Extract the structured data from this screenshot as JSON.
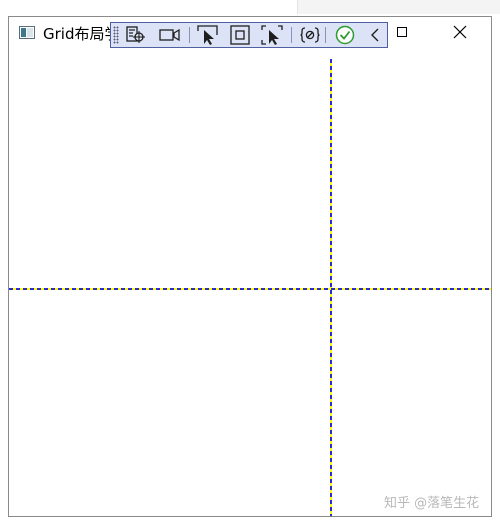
{
  "window": {
    "title": "Grid布局学"
  },
  "toolbar": {
    "buttons": [
      {
        "name": "live-visual-tree-icon"
      },
      {
        "name": "record-icon"
      },
      {
        "name": "select-element-icon"
      },
      {
        "name": "display-layout-adorners-icon"
      },
      {
        "name": "track-focus-icon"
      },
      {
        "name": "binding-failures-icon"
      },
      {
        "name": "accessibility-check-icon"
      },
      {
        "name": "collapse-toolbar-icon"
      }
    ]
  },
  "colors": {
    "toolbar_bg": "#dde3f7",
    "toolbar_border": "#4f5fa0",
    "gridline_a": "#2b2bd6",
    "gridline_b": "#ffff00",
    "check_green": "#2e9b2e"
  },
  "watermark": {
    "text": "知乎 @落笔生花"
  }
}
